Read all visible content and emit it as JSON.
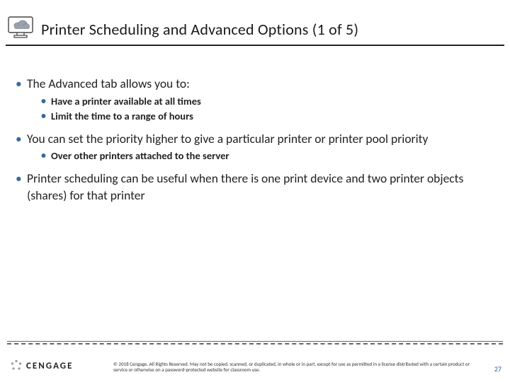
{
  "header": {
    "title": "Printer Scheduling and Advanced Options (1 of 5)"
  },
  "body": {
    "items": [
      {
        "text": "The Advanced tab allows you to:",
        "sub": [
          "Have a printer available at all times",
          "Limit the time to a range of hours"
        ]
      },
      {
        "text": "You can set the priority higher to give a particular printer or printer pool priority",
        "sub": [
          "Over other printers attached to the server"
        ]
      },
      {
        "text": "Printer scheduling can be useful when there is one print device and two printer objects (shares) for that printer",
        "sub": []
      }
    ]
  },
  "footer": {
    "brand": "CENGAGE",
    "copyright": "© 2018 Cengage. All Rights Reserved. May not be copied, scanned, or duplicated, in whole or in part, except for use as permitted in a license distributed with a certain product or service or otherwise on a password-protected website for classroom use.",
    "page": "27"
  }
}
